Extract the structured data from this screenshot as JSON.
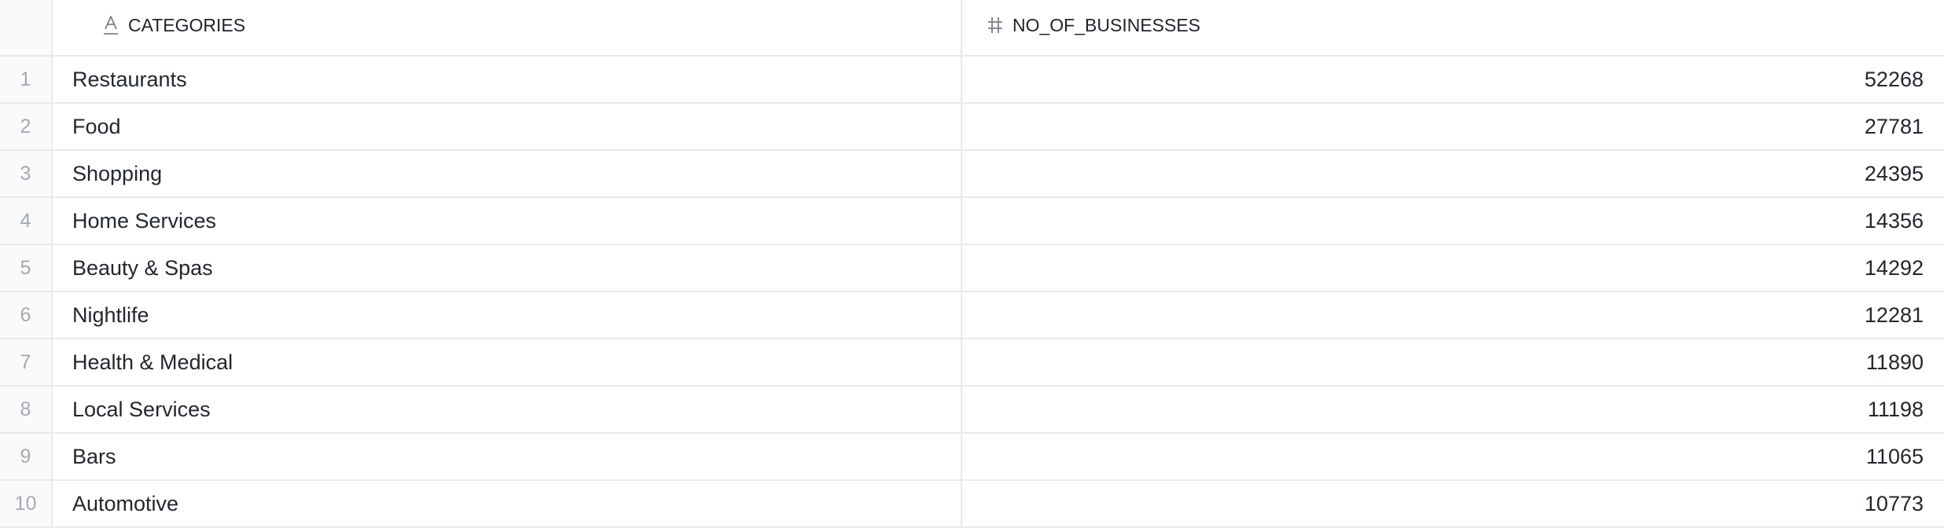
{
  "columns": {
    "categories": {
      "label": "CATEGORIES",
      "type_icon": "text-type-icon"
    },
    "no_of_businesses": {
      "label": "NO_OF_BUSINESSES",
      "type_icon": "number-type-icon"
    }
  },
  "rows": [
    {
      "index": "1",
      "category": "Restaurants",
      "count": "52268"
    },
    {
      "index": "2",
      "category": "Food",
      "count": "27781"
    },
    {
      "index": "3",
      "category": "Shopping",
      "count": "24395"
    },
    {
      "index": "4",
      "category": "Home Services",
      "count": "14356"
    },
    {
      "index": "5",
      "category": "Beauty & Spas",
      "count": "14292"
    },
    {
      "index": "6",
      "category": "Nightlife",
      "count": "12281"
    },
    {
      "index": "7",
      "category": "Health & Medical",
      "count": "11890"
    },
    {
      "index": "8",
      "category": "Local Services",
      "count": "11198"
    },
    {
      "index": "9",
      "category": "Bars",
      "count": "11065"
    },
    {
      "index": "10",
      "category": "Automotive",
      "count": "10773"
    }
  ]
}
